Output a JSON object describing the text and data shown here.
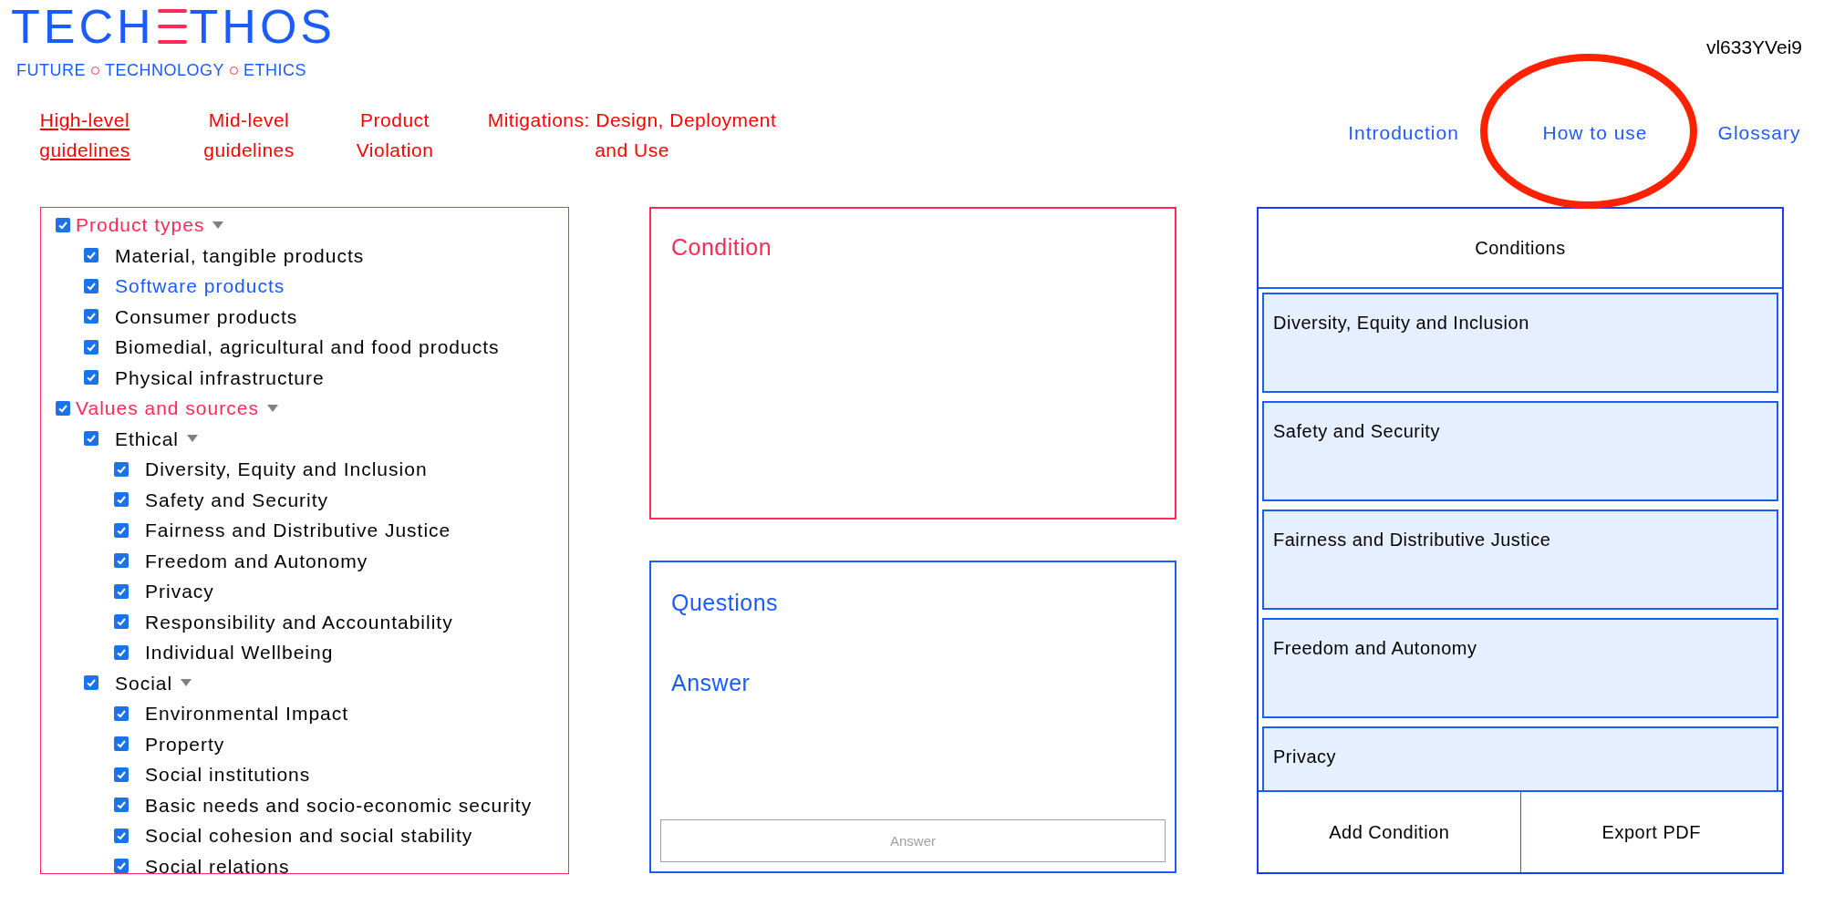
{
  "logo": {
    "left": "TECH",
    "right": "THOS",
    "tagline": [
      "FUTURE",
      "TECHNOLOGY",
      "ETHICS"
    ]
  },
  "version": "vl633YVei9",
  "main_nav": [
    {
      "label": "High-level guidelines",
      "selected": true
    },
    {
      "label": "Mid-level guidelines",
      "selected": false
    },
    {
      "label": "Product Violation",
      "selected": false
    },
    {
      "label": "Mitigations: Design, Deployment and Use",
      "selected": false
    }
  ],
  "secondary_nav": [
    {
      "label": "Introduction",
      "circled": false
    },
    {
      "label": "How to use",
      "circled": true
    },
    {
      "label": "Glossary",
      "circled": false
    }
  ],
  "filter_tree": [
    {
      "label": "Product types",
      "checked": true,
      "expanded": true,
      "children": [
        {
          "label": "Material, tangible products",
          "checked": true,
          "highlighted": false
        },
        {
          "label": "Software products",
          "checked": true,
          "highlighted": true
        },
        {
          "label": "Consumer products",
          "checked": true,
          "highlighted": false
        },
        {
          "label": "Biomedial, agricultural and food products",
          "checked": true,
          "highlighted": false
        },
        {
          "label": "Physical infrastructure",
          "checked": true,
          "highlighted": false
        }
      ]
    },
    {
      "label": "Values and sources",
      "checked": true,
      "expanded": true,
      "children": [
        {
          "label": "Ethical",
          "checked": true,
          "expanded": true,
          "highlighted": false,
          "children": [
            {
              "label": "Diversity, Equity and Inclusion",
              "checked": true,
              "highlighted": false
            },
            {
              "label": "Safety and Security",
              "checked": true,
              "highlighted": false
            },
            {
              "label": "Fairness and Distributive Justice",
              "checked": true,
              "highlighted": false
            },
            {
              "label": "Freedom and Autonomy",
              "checked": true,
              "highlighted": false
            },
            {
              "label": "Privacy",
              "checked": true,
              "highlighted": false
            },
            {
              "label": "Responsibility and Accountability",
              "checked": true,
              "highlighted": false
            },
            {
              "label": "Individual Wellbeing",
              "checked": true,
              "highlighted": false
            }
          ]
        },
        {
          "label": "Social",
          "checked": true,
          "expanded": true,
          "highlighted": false,
          "children": [
            {
              "label": "Environmental Impact",
              "checked": true,
              "highlighted": false
            },
            {
              "label": "Property",
              "checked": true,
              "highlighted": false
            },
            {
              "label": "Social institutions",
              "checked": true,
              "highlighted": false
            },
            {
              "label": "Basic needs and socio-economic security",
              "checked": true,
              "highlighted": false
            },
            {
              "label": "Social cohesion and social stability",
              "checked": true,
              "highlighted": false
            },
            {
              "label": "Social relations",
              "checked": true,
              "highlighted": false
            }
          ]
        }
      ]
    }
  ],
  "condition_panel": {
    "title": "Condition"
  },
  "questions_panel": {
    "title": "Questions",
    "answer_heading": "Answer",
    "answer_field": {
      "placeholder": "Answer"
    }
  },
  "conditions_panel": {
    "title": "Conditions",
    "items": [
      "Diversity, Equity and Inclusion",
      "Safety and Security",
      "Fairness and Distributive Justice",
      "Freedom and Autonomy",
      "Privacy"
    ],
    "buttons": [
      "Add Condition",
      "Export PDF"
    ]
  }
}
